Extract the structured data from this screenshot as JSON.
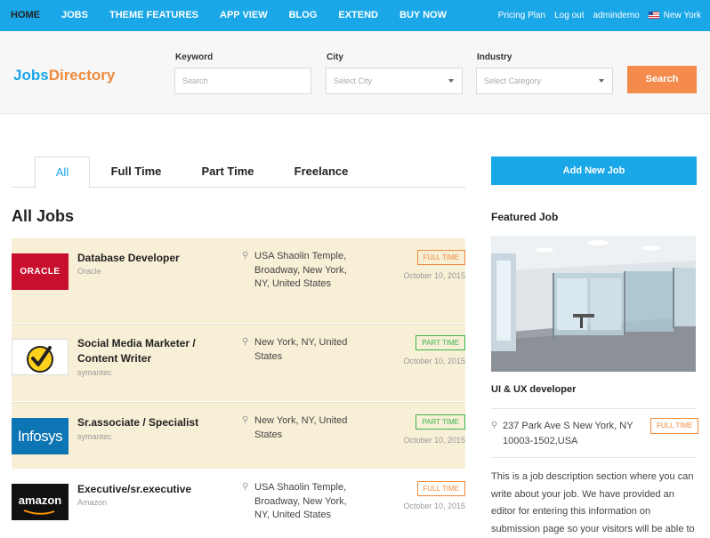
{
  "nav": {
    "items": [
      "HOME",
      "JOBS",
      "THEME FEATURES",
      "APP VIEW",
      "BLOG",
      "EXTEND",
      "BUY NOW"
    ],
    "right": {
      "pricing": "Pricing Plan",
      "logout": "Log out",
      "user": "admindemo",
      "location": "New York"
    }
  },
  "brand": {
    "part1": "Jobs",
    "part2": "Directory"
  },
  "search": {
    "keyword_label": "Keyword",
    "keyword_placeholder": "Search",
    "city_label": "City",
    "city_value": "Select City",
    "industry_label": "Industry",
    "industry_value": "Select Category",
    "button": "Search"
  },
  "tabs": [
    "All",
    "Full Time",
    "Part Time",
    "Freelance"
  ],
  "section_title": "All Jobs",
  "jobs": [
    {
      "title": "Database Developer",
      "company": "Oracle",
      "location": "USA Shaolin Temple, Broadway, New York, NY, United States",
      "type": "FULL TIME",
      "date": "October 10, 2015",
      "logo": "ORACLE"
    },
    {
      "title": "Social Media Marketer / Content Writer",
      "company": "symantec",
      "location": "New York, NY, United States",
      "type": "PART TIME",
      "date": "October 10, 2015",
      "logo": "symantec-check"
    },
    {
      "title": "Sr.associate / Specialist",
      "company": "symantec",
      "location": "New York, NY, United States",
      "type": "PART TIME",
      "date": "October 10, 2015",
      "logo": "Infosys"
    },
    {
      "title": "Executive/sr.executive",
      "company": "Amazon",
      "location": "USA Shaolin Temple, Broadway, New York, NY, United States",
      "type": "FULL TIME",
      "date": "October 10, 2015",
      "logo": "amazon"
    }
  ],
  "sidebar": {
    "add_button": "Add New Job",
    "featured_heading": "Featured Job",
    "featured_title": "UI & UX developer",
    "featured_address": "237 Park Ave S New York, NY 10003-1502,USA",
    "featured_type": "FULL TIME",
    "featured_desc": "This is a job description section where you can write about your job. We have provided an editor for entering this information on submission page so your visitors will be able to"
  },
  "colors": {
    "primary": "#1aa7e8",
    "accent": "#f48a4c",
    "highlight": "#f7efd6",
    "part_time": "#3ab54a"
  }
}
